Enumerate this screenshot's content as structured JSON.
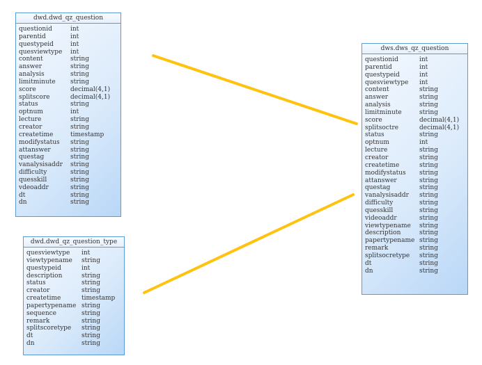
{
  "connector_color": "#ffc20e",
  "tables": [
    {
      "title": "dwd.dwd_qz_question",
      "columns": [
        [
          "questionid",
          "int"
        ],
        [
          "parentid",
          "int"
        ],
        [
          "questypeid",
          "int"
        ],
        [
          "quesviewtype",
          "int"
        ],
        [
          "content",
          "string"
        ],
        [
          "answer",
          "string"
        ],
        [
          "analysis",
          "string"
        ],
        [
          "limitminute",
          "string"
        ],
        [
          "score",
          "decimal(4,1)"
        ],
        [
          "splitscore",
          "decimal(4,1)"
        ],
        [
          "status",
          "string"
        ],
        [
          "optnum",
          "int"
        ],
        [
          "lecture",
          "string"
        ],
        [
          "creator",
          "string"
        ],
        [
          "createtime",
          "timestamp"
        ],
        [
          "modifystatus",
          "string"
        ],
        [
          "attanswer",
          "string"
        ],
        [
          "questag",
          "string"
        ],
        [
          "vanalysisaddr",
          "string"
        ],
        [
          "difficulty",
          "string"
        ],
        [
          "quesskill",
          "string"
        ],
        [
          "vdeoaddr",
          "string"
        ],
        [
          "dt",
          "string"
        ],
        [
          "dn",
          "string"
        ]
      ]
    },
    {
      "title": "dwd.dwd_qz_question_type",
      "columns": [
        [
          "quesviewtype",
          "int"
        ],
        [
          "viewtypename",
          "string"
        ],
        [
          "questypeid",
          "int"
        ],
        [
          "description",
          "string"
        ],
        [
          "status",
          "string"
        ],
        [
          "creator",
          "string"
        ],
        [
          "createtime",
          "timestamp"
        ],
        [
          "papertypename",
          "string"
        ],
        [
          "sequence",
          "string"
        ],
        [
          "remark",
          "string"
        ],
        [
          "splitscoretype",
          "string"
        ],
        [
          "dt",
          "string"
        ],
        [
          "dn",
          "string"
        ]
      ]
    },
    {
      "title": "dws.dws_qz_question",
      "columns": [
        [
          "questionid",
          "int"
        ],
        [
          "parentid",
          "int"
        ],
        [
          "questypeid",
          "int"
        ],
        [
          "quesviewtype",
          "int"
        ],
        [
          "content",
          "string"
        ],
        [
          "answer",
          "string"
        ],
        [
          "analysis",
          "string"
        ],
        [
          "limitminute",
          "string"
        ],
        [
          "score",
          "decimal(4,1)"
        ],
        [
          "splitsoctre",
          "decimal(4,1)"
        ],
        [
          "status",
          "string"
        ],
        [
          "optnum",
          "int"
        ],
        [
          "lecture",
          "string"
        ],
        [
          "creator",
          "string"
        ],
        [
          "createtime",
          "string"
        ],
        [
          "modifystatus",
          "string"
        ],
        [
          "attanswer",
          "string"
        ],
        [
          "questag",
          "string"
        ],
        [
          "vanalysisaddr",
          "string"
        ],
        [
          "difficulty",
          "string"
        ],
        [
          "quesskill",
          "string"
        ],
        [
          "videoaddr",
          "string"
        ],
        [
          "viewtypename",
          "string"
        ],
        [
          "description",
          "string"
        ],
        [
          "papertypename",
          "string"
        ],
        [
          "remark",
          "string"
        ],
        [
          "splitsocretype",
          "string"
        ],
        [
          "dt",
          "string"
        ],
        [
          "dn",
          "string"
        ]
      ]
    }
  ]
}
